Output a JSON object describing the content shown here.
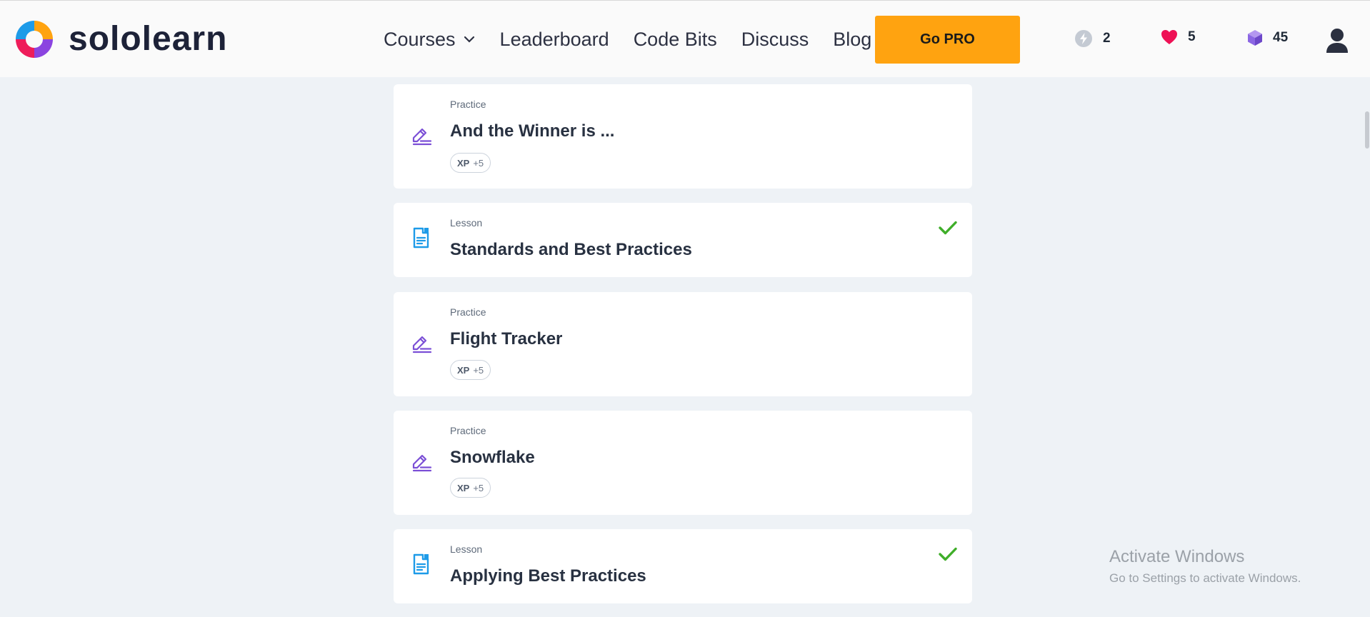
{
  "brand": {
    "name": "sololearn"
  },
  "nav": {
    "courses": "Courses",
    "leaderboard": "Leaderboard",
    "code_bits": "Code Bits",
    "discuss": "Discuss",
    "blog": "Blog"
  },
  "go_pro": "Go PRO",
  "stats": {
    "streak": "2",
    "hearts": "5",
    "gems": "45"
  },
  "items": [
    {
      "type": "Practice",
      "title": "And the Winner is ...",
      "xp_label": "XP",
      "xp_value": "+5"
    },
    {
      "type": "Lesson",
      "title": "Standards and Best Practices",
      "completed": true
    },
    {
      "type": "Practice",
      "title": "Flight Tracker",
      "xp_label": "XP",
      "xp_value": "+5"
    },
    {
      "type": "Practice",
      "title": "Snowflake",
      "xp_label": "XP",
      "xp_value": "+5"
    },
    {
      "type": "Lesson",
      "title": "Applying Best Practices",
      "completed": true
    }
  ],
  "watermark": {
    "title": "Activate Windows",
    "subtitle": "Go to Settings to activate Windows."
  },
  "colors": {
    "accent": "#ffa310",
    "practice_icon": "#7b4fd6",
    "lesson_icon": "#1e9be8",
    "check": "#3fae29",
    "heart": "#ee1155",
    "gem": "#8b66e3"
  },
  "icons": {
    "practice": "pencil-lines-icon",
    "lesson": "document-icon",
    "completed": "checkmark-icon",
    "streak": "lightning-icon",
    "hearts": "heart-icon",
    "gems": "gem-icon"
  }
}
